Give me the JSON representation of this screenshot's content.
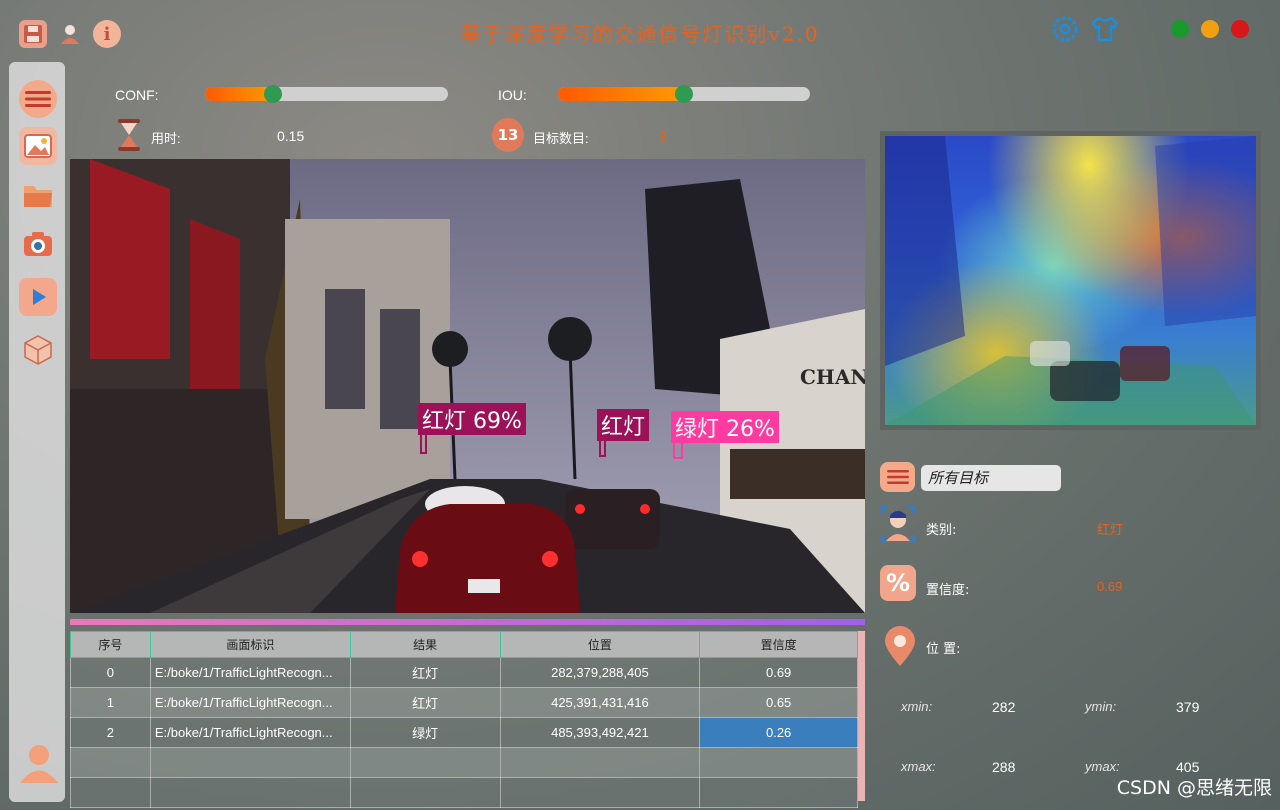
{
  "window": {
    "title": "基于深度学习的交通信号灯识别v2.0",
    "controls_colors": [
      "#1a9a2c",
      "#f0a010",
      "#d81818"
    ]
  },
  "toolbar_icons": [
    "save-icon",
    "user-icon",
    "info-icon",
    "settings-icon",
    "shirt-icon"
  ],
  "sidebar": {
    "items": [
      "menu-icon",
      "image-icon",
      "folder-icon",
      "camera-icon",
      "video-icon",
      "model-icon"
    ],
    "bottom": "avatar-icon"
  },
  "params": {
    "conf_label": "CONF:",
    "conf_value": 0.28,
    "iou_label": "IOU:",
    "iou_value": 0.5
  },
  "stats": {
    "time_label": "用时:",
    "time_value": "0.15",
    "count_label": "目标数目:",
    "count_value": "3",
    "count_icon_text": "13"
  },
  "detections": [
    {
      "label": "红灯  69%",
      "color": "#9c1258"
    },
    {
      "label": "红灯",
      "color": "#9c1258"
    },
    {
      "label": "绿灯  26%",
      "color": "#ff3aa0"
    }
  ],
  "table": {
    "headers": [
      "序号",
      "画面标识",
      "结果",
      "位置",
      "置信度"
    ],
    "rows": [
      [
        "0",
        "E:/boke/1/TrafficLightRecogn...",
        "红灯",
        "282,379,288,405",
        "0.69"
      ],
      [
        "1",
        "E:/boke/1/TrafficLightRecogn...",
        "红灯",
        "425,391,431,416",
        "0.65"
      ],
      [
        "2",
        "E:/boke/1/TrafficLightRecogn...",
        "绿灯",
        "485,393,492,421",
        "0.26"
      ]
    ],
    "empty_rows": 2,
    "selected_color": "#3a7ebd"
  },
  "panel": {
    "filter_value": "所有目标",
    "class_label": "类别:",
    "class_value": "红灯",
    "conf_label": "置信度:",
    "conf_value": "0.69",
    "pos_label": "位 置:",
    "xmin_label": "xmin:",
    "xmin": "282",
    "ymin_label": "ymin:",
    "ymin": "379",
    "xmax_label": "xmax:",
    "xmax": "288",
    "ymax_label": "ymax:",
    "ymax": "405"
  },
  "watermark": "CSDN @思绪无限",
  "accent_color": "#e8621d"
}
